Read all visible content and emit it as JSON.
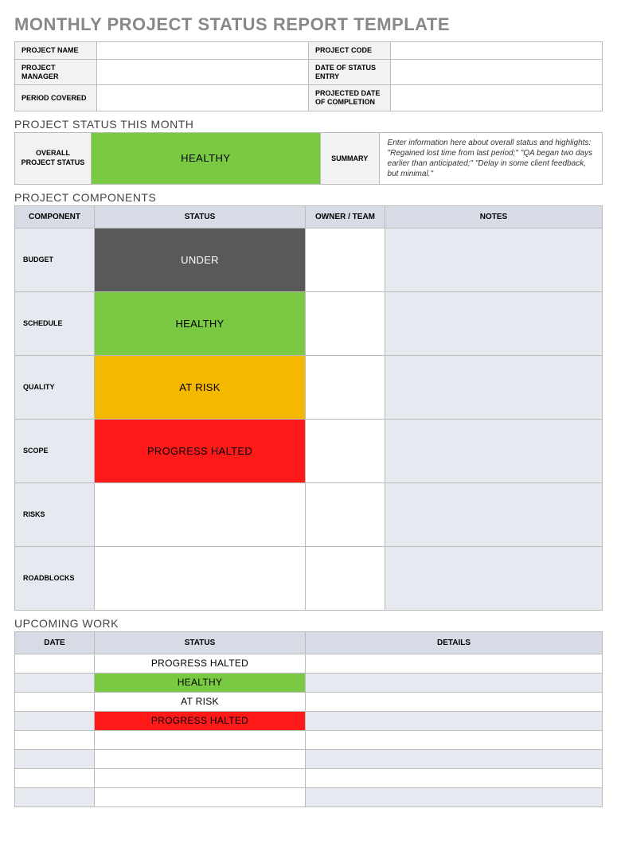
{
  "title": "MONTHLY PROJECT STATUS REPORT TEMPLATE",
  "meta": {
    "labels": {
      "projectName": "PROJECT NAME",
      "projectCode": "PROJECT CODE",
      "projectManager": "PROJECT MANAGER",
      "dateOfEntry": "DATE OF STATUS ENTRY",
      "periodCovered": "PERIOD COVERED",
      "projectedCompletion": "PROJECTED DATE OF COMPLETION"
    },
    "values": {
      "projectName": "",
      "projectCode": "",
      "projectManager": "",
      "dateOfEntry": "",
      "periodCovered": "",
      "projectedCompletion": ""
    }
  },
  "sections": {
    "statusThisMonth": "PROJECT STATUS THIS MONTH",
    "components": "PROJECT COMPONENTS",
    "upcoming": "UPCOMING WORK"
  },
  "overall": {
    "label": "OVERALL PROJECT STATUS",
    "status": "HEALTHY",
    "summaryLabel": "SUMMARY",
    "summaryText": "Enter information here about overall status and highlights: \"Regained lost time from last period;\" \"QA began two days earlier than anticipated;\" \"Delay in some client feedback, but minimal.\""
  },
  "components": {
    "headers": {
      "component": "COMPONENT",
      "status": "STATUS",
      "owner": "OWNER / TEAM",
      "notes": "NOTES"
    },
    "rows": [
      {
        "name": "BUDGET",
        "status": "UNDER",
        "color": "c-dark",
        "owner": "",
        "notes": ""
      },
      {
        "name": "SCHEDULE",
        "status": "HEALTHY",
        "color": "c-green",
        "owner": "",
        "notes": ""
      },
      {
        "name": "QUALITY",
        "status": "AT RISK",
        "color": "c-yellow",
        "owner": "",
        "notes": ""
      },
      {
        "name": "SCOPE",
        "status": "PROGRESS HALTED",
        "color": "c-red",
        "owner": "",
        "notes": ""
      },
      {
        "name": "RISKS",
        "status": "",
        "color": "c-empty",
        "owner": "",
        "notes": ""
      },
      {
        "name": "ROADBLOCKS",
        "status": "",
        "color": "c-empty",
        "owner": "",
        "notes": ""
      }
    ]
  },
  "upcoming": {
    "headers": {
      "date": "DATE",
      "status": "STATUS",
      "details": "DETAILS"
    },
    "rows": [
      {
        "date": "",
        "status": "PROGRESS HALTED",
        "color": "c-red",
        "details": "",
        "alt": false
      },
      {
        "date": "",
        "status": "HEALTHY",
        "color": "c-green",
        "details": "",
        "alt": true
      },
      {
        "date": "",
        "status": "AT RISK",
        "color": "c-yellow",
        "details": "",
        "alt": false
      },
      {
        "date": "",
        "status": "PROGRESS HALTED",
        "color": "c-red",
        "details": "",
        "alt": true
      },
      {
        "date": "",
        "status": "",
        "color": "c-empty",
        "details": "",
        "alt": false
      },
      {
        "date": "",
        "status": "",
        "color": "c-empty",
        "details": "",
        "alt": true
      },
      {
        "date": "",
        "status": "",
        "color": "c-empty",
        "details": "",
        "alt": false
      },
      {
        "date": "",
        "status": "",
        "color": "c-empty",
        "details": "",
        "alt": true
      }
    ]
  }
}
